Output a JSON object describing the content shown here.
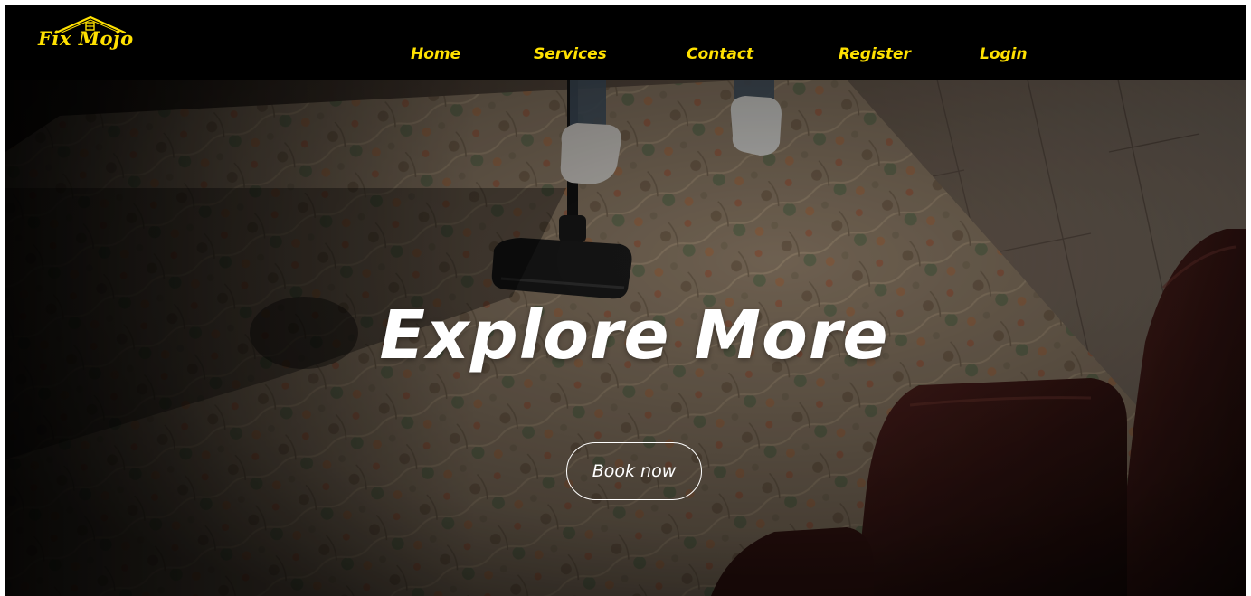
{
  "brand": {
    "name": "Fix Mojo",
    "color": "#ffe100",
    "icon": "house-roof-icon"
  },
  "nav": {
    "items": [
      {
        "label": "Home"
      },
      {
        "label": "Services"
      },
      {
        "label": "Contact"
      },
      {
        "label": "Register"
      },
      {
        "label": "Login"
      }
    ],
    "text_color": "#ffe100",
    "background": "#000000"
  },
  "hero": {
    "title": "Explore More",
    "button_label": "Book now",
    "image": "photo-vacuum-cleaning-patterned-rug-with-leather-sofa"
  }
}
